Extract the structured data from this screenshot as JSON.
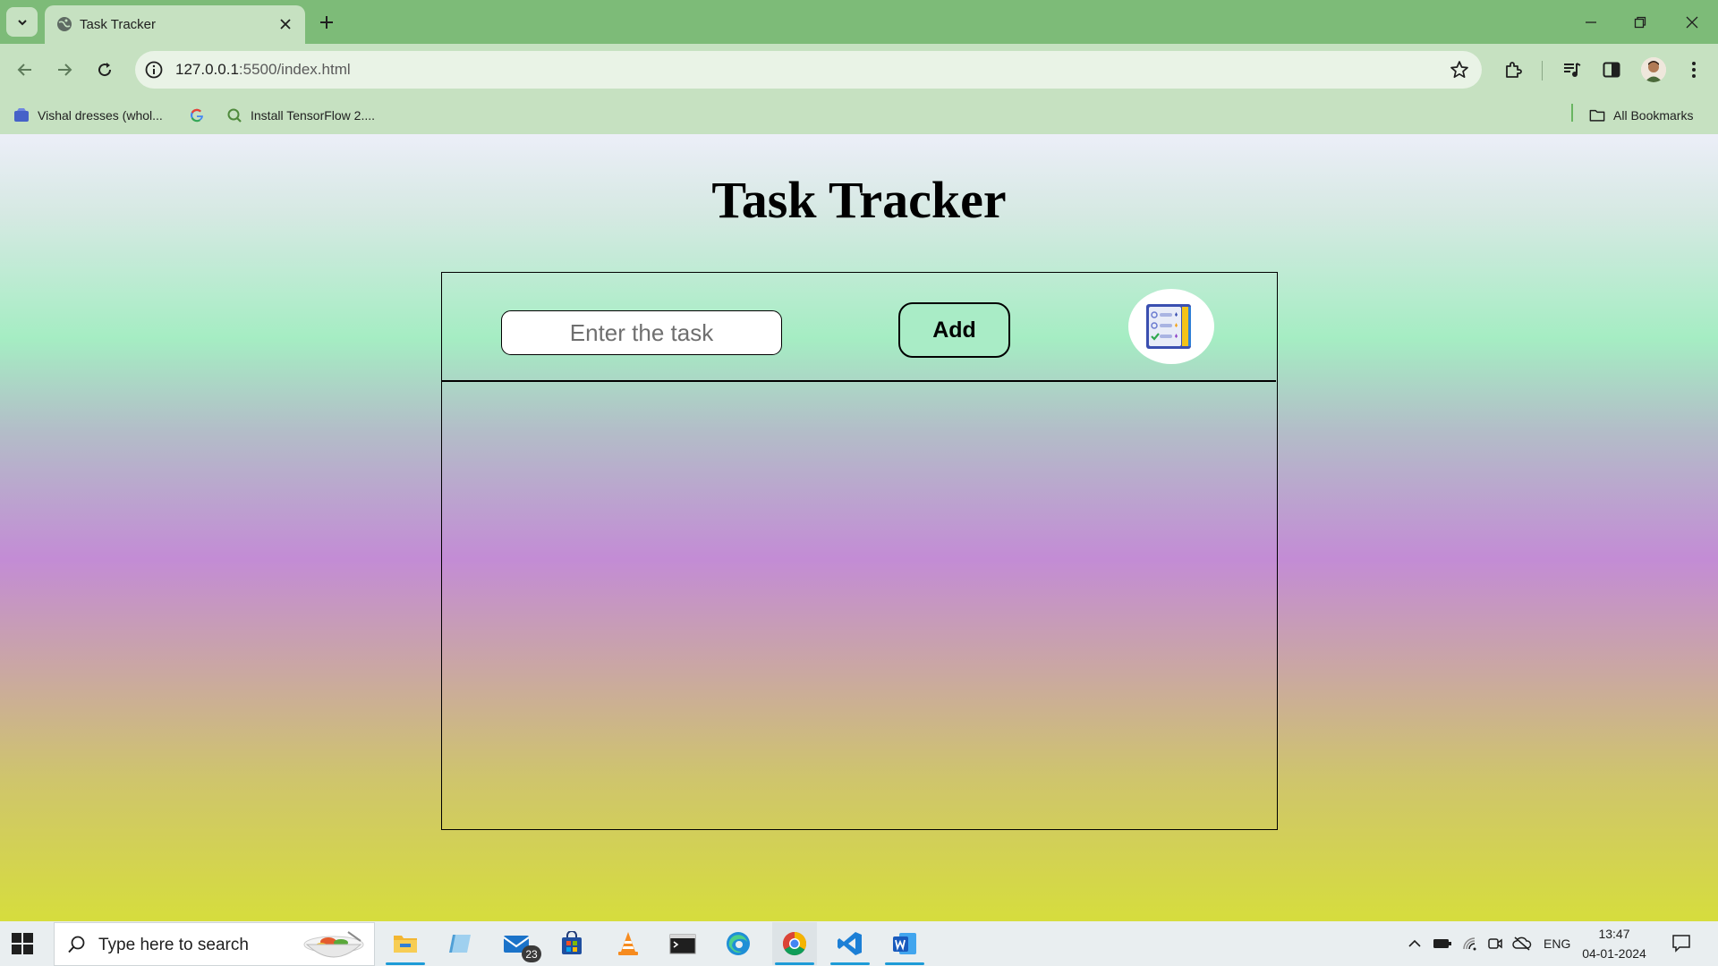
{
  "browser": {
    "tab": {
      "title": "Task Tracker"
    },
    "address": {
      "host": "127.0.0.1",
      "path": ":5500/index.html"
    },
    "bookmarks": [
      {
        "label": "Vishal dresses (whol..."
      },
      {
        "label": ""
      },
      {
        "label": "Install TensorFlow 2...."
      }
    ],
    "all_bookmarks_label": "All Bookmarks"
  },
  "page": {
    "title": "Task Tracker",
    "task_input": {
      "placeholder": "Enter the task",
      "value": ""
    },
    "add_button_label": "Add",
    "tasks": []
  },
  "taskbar": {
    "search_placeholder": "Type here to search",
    "mail_badge": "23",
    "language": "ENG",
    "time": "13:47",
    "date": "04-01-2024"
  },
  "colors": {
    "chrome_frame": "#7dbb78",
    "chrome_toolbar": "#c6e1c1",
    "add_button_bg": "#a9ecc6",
    "taskbar": "#e9eef0"
  }
}
